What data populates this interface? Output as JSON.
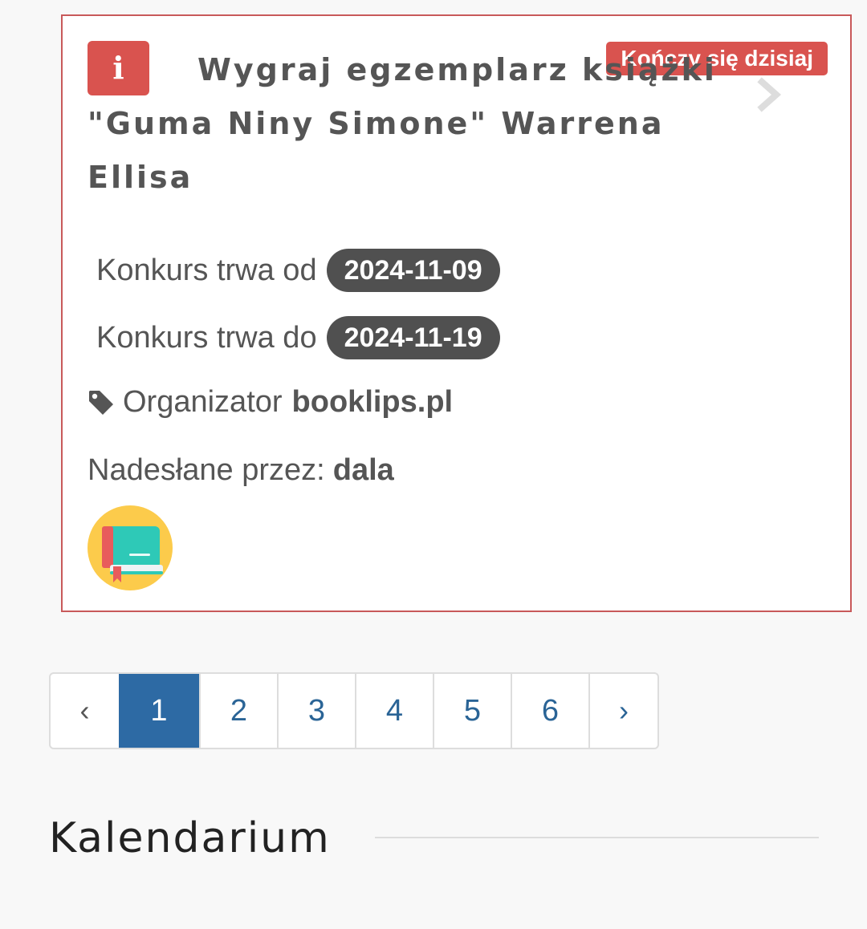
{
  "contest": {
    "badge_icon": "i",
    "status_badge": "Kończy się dzisiaj",
    "title": "Wygraj egzemplarz książki \"Guma Niny Simone\" Warrena Ellisa",
    "start_label": "Konkurs trwa od",
    "start_date": "2024-11-09",
    "end_label": "Konkurs trwa do",
    "end_date": "2024-11-19",
    "organizer_label": "Organizator",
    "organizer_value": "booklips.pl",
    "submitted_label": "Nadesłane przez:",
    "submitted_user": "dala",
    "colors": {
      "accent_red": "#d9534f",
      "pill_dark": "#505050"
    }
  },
  "pagination": {
    "prev": "‹",
    "pages": [
      "1",
      "2",
      "3",
      "4",
      "5",
      "6"
    ],
    "active_page": "1",
    "next": "›",
    "active_color": "#2d6aa4"
  },
  "section": {
    "title": "Kalendarium"
  },
  "icons": {
    "info": "info-icon",
    "chevron": "chevron-right-icon",
    "tag": "tag-icon",
    "avatar": "book-avatar-icon"
  }
}
